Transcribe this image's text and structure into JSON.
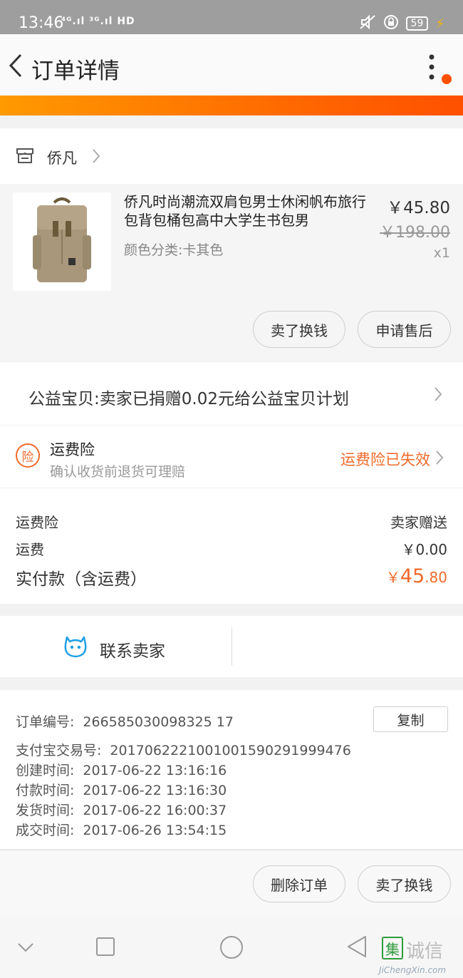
{
  "status_bar": {
    "time": "13:46",
    "signal": "⁴ᴳ.ıl ³ᴳ.ıl HD",
    "battery": "59"
  },
  "header": {
    "title": "订单详情",
    "accent_color": "#ff5000"
  },
  "shop": {
    "name": "侨凡"
  },
  "product": {
    "title": "侨凡时尚潮流双肩包男士休闲帆布旅行包背包桶包高中大学生书包男",
    "variant": "颜色分类:卡其色",
    "price": "￥45.80",
    "original_price": "￥198.00",
    "quantity": "x1",
    "buttons": {
      "sell": "卖了换钱",
      "after_sale": "申请售后"
    }
  },
  "charity": {
    "text": "公益宝贝:卖家已捐赠0.02元给公益宝贝计划"
  },
  "insurance": {
    "badge": "险",
    "title": "运费险",
    "subtitle": "确认收货前退货可理赔",
    "status": "运费险已失效"
  },
  "costs": {
    "insurance_label": "运费险",
    "insurance_value": "卖家赠送",
    "shipping_label": "运费",
    "shipping_value": "￥0.00",
    "paid_label": "实付款（含运费）",
    "paid_currency": "￥",
    "paid_integer": "45",
    "paid_decimal": ".80"
  },
  "contact": {
    "label": "联系卖家"
  },
  "order_info": {
    "order_no_label": "订单编号:",
    "order_no": "266585030098325 17",
    "copy_label": "复制",
    "alipay_label": "支付宝交易号:",
    "alipay_no": "2017062221001001590291999476",
    "created_label": "创建时间:",
    "created": "2017-06-22 13:16:16",
    "paid_label": "付款时间:",
    "paid": "2017-06-22 13:16:30",
    "shipped_label": "发货时间:",
    "shipped": "2017-06-22 16:00:37",
    "done_label": "成交时间:",
    "done": "2017-06-26 13:54:15"
  },
  "bottom_actions": {
    "delete": "删除订单",
    "sell": "卖了换钱"
  },
  "watermark": {
    "logo": "集",
    "text": "诚信",
    "url": "JiChengXin.com"
  }
}
